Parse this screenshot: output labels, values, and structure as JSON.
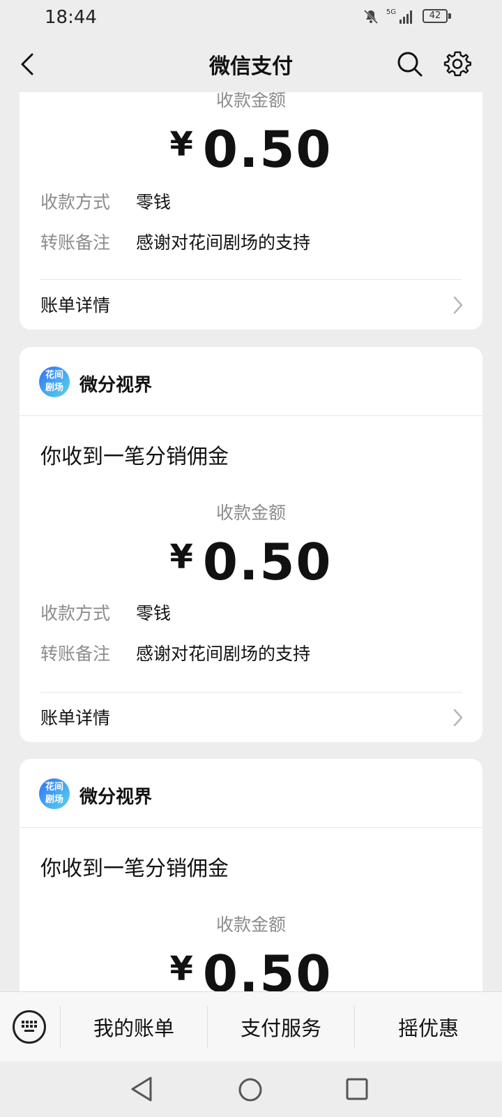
{
  "status_bar": {
    "time": "18:44",
    "battery": "42",
    "network": "5G"
  },
  "header": {
    "title": "微信支付"
  },
  "cards": [
    {
      "amount_label": "收款金额",
      "currency": "¥",
      "amount": "0.50",
      "rows": [
        {
          "label": "收款方式",
          "value": "零钱"
        },
        {
          "label": "转账备注",
          "value": "感谢对花间剧场的支持"
        }
      ],
      "detail_label": "账单详情"
    },
    {
      "merchant": "微分视界",
      "avatar_text": [
        "花间",
        "剧场"
      ],
      "title": "你收到一笔分销佣金",
      "amount_label": "收款金额",
      "currency": "¥",
      "amount": "0.50",
      "rows": [
        {
          "label": "收款方式",
          "value": "零钱"
        },
        {
          "label": "转账备注",
          "value": "感谢对花间剧场的支持"
        }
      ],
      "detail_label": "账单详情"
    },
    {
      "merchant": "微分视界",
      "avatar_text": [
        "花间",
        "剧场"
      ],
      "title": "你收到一笔分销佣金",
      "amount_label": "收款金额",
      "currency": "¥",
      "amount": "0.50"
    }
  ],
  "tabbar": {
    "tabs": [
      "我的账单",
      "支付服务",
      "摇优惠"
    ]
  },
  "icons": {
    "back": "back-arrow-icon",
    "search": "search-icon",
    "settings": "gear-icon",
    "keyboard": "keyboard-icon",
    "nav_back": "nav-back-icon",
    "nav_home": "nav-home-icon",
    "nav_recents": "nav-recents-icon"
  }
}
